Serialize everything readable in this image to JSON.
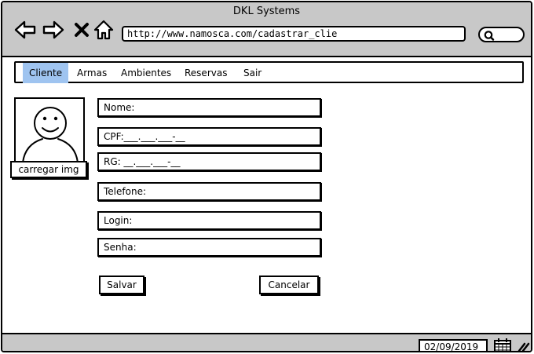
{
  "window": {
    "title": "DKL Systems"
  },
  "browser": {
    "url": "http://www.namosca.com/cadastrar_clie",
    "icons": [
      "back-arrow-icon",
      "forward-arrow-icon",
      "close-x-icon",
      "home-icon",
      "search-icon"
    ]
  },
  "menu": {
    "items": [
      {
        "label": "Cliente",
        "active": true
      },
      {
        "label": "Armas",
        "active": false
      },
      {
        "label": "Ambientes",
        "active": false
      },
      {
        "label": "Reservas",
        "active": false
      },
      {
        "label": "Sair",
        "active": false
      }
    ],
    "active_color": "#9fc4f0"
  },
  "profile": {
    "upload_label": "carregar img"
  },
  "form": {
    "nome": "Nome:",
    "cpf": "CPF:___.___.___-__",
    "rg": "RG: __.___.___-__",
    "telefone": "Telefone:",
    "login": "Login:",
    "senha": "Senha:"
  },
  "actions": {
    "save_label": "Salvar",
    "cancel_label": "Cancelar"
  },
  "status": {
    "date": "02/09/2019"
  },
  "colors": {
    "chrome": "#c8c8c8",
    "border": "#000000",
    "background": "#ffffff"
  }
}
